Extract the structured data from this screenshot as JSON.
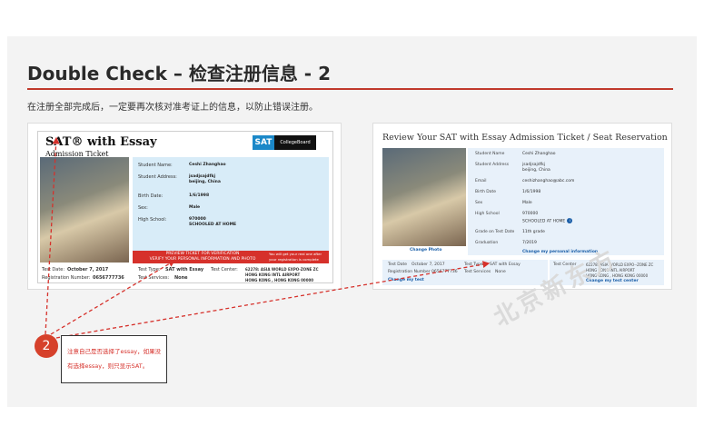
{
  "slide": {
    "title": "Double Check – 检查注册信息 - 2",
    "subtitle": "在注册全部完成后，一定要再次核对准考证上的信息，以防止错误注册。",
    "step_number": "2",
    "note_line1": "注意自己是否选择了essay，如果没",
    "note_line2": "有选择essay，则只显示SAT。",
    "watermark": "北京新东方"
  },
  "left_ticket": {
    "logo": "SAT® with Essay",
    "logo_sub": "Admission Ticket",
    "sat_badge": "SAT",
    "collegeboard": "CollegeBoard",
    "fields": [
      {
        "label": "Student Name:",
        "value": "Ceshi Zhanghao"
      },
      {
        "label": "Student Address:",
        "value": "jsadjsajdfkj"
      },
      {
        "label": "",
        "value": "beijing, China"
      },
      {
        "label": "Birth Date:",
        "value": "1/6/1998"
      },
      {
        "label": "Sex:",
        "value": "Male"
      },
      {
        "label": "High School:",
        "value": "970000"
      },
      {
        "label": "",
        "value": "SCHOOLED AT HOME"
      }
    ],
    "banner_line1": "PREVIEW TICKET FOR VERIFICATION",
    "banner_line2": "VERIFY YOUR PERSONAL INFORMATION AND PHOTO",
    "banner_right1": "You will get your real one after",
    "banner_right2": "your registration is complete",
    "test_date_label": "Test Date:",
    "test_date": "October 7, 2017",
    "reg_label": "Registration Number:",
    "reg_number": "0656777736",
    "test_type_label": "Test Type:",
    "test_type": "SAT with Essay",
    "services_label": "Test Services:",
    "services": "None",
    "center_label": "Test Center:",
    "center1": "62278: ASIA WORLD EXPO-ZONE ZC",
    "center2": "HONG KONG INTL AIRPORT",
    "center3": "HONG KONG , HONG KONG 00000"
  },
  "right_ticket": {
    "title": "Review Your SAT with Essay Admission Ticket / Seat Reservation",
    "fields": [
      {
        "label": "Student Name",
        "value": "Ceshi Zhanghao"
      },
      {
        "label": "Student Address",
        "value": "jsadjsajdfkj"
      },
      {
        "label": "",
        "value": "beijing, China"
      },
      {
        "label": "Email",
        "value": "ceshizhanghao@abc.com"
      },
      {
        "label": "Birth Date",
        "value": "1/6/1998"
      },
      {
        "label": "Sex",
        "value": "Male"
      },
      {
        "label": "High School",
        "value": "970000"
      },
      {
        "label": "",
        "value": "SCHOOLED AT HOME"
      },
      {
        "label": "Grade on Test Date",
        "value": "11th grade"
      },
      {
        "label": "Graduation",
        "value": "7/2019"
      }
    ],
    "change_photo": "Change Photo",
    "change_personal": "Change my personal information",
    "test_date_label": "Test Date",
    "test_date": "October 7, 2017",
    "reg_label": "Registration Number",
    "reg_number": "0656777736",
    "change_test": "Change my test",
    "test_type_label": "Test Type",
    "test_type": "SAT with Essay",
    "services_label": "Test Services",
    "services": "None",
    "center_label": "Test Center",
    "center1": "62278: ASIA WORLD EXPO--ZONE ZC",
    "center2": "HONG KONG INTL AIRPORT",
    "center3": "HONG KONG , HONG KONG 00000",
    "change_center": "Change my test center"
  },
  "colors": {
    "accent": "#c0392b",
    "banner": "#d6312b",
    "info_bg": "#d8ecf8",
    "link": "#1b5fa8"
  }
}
